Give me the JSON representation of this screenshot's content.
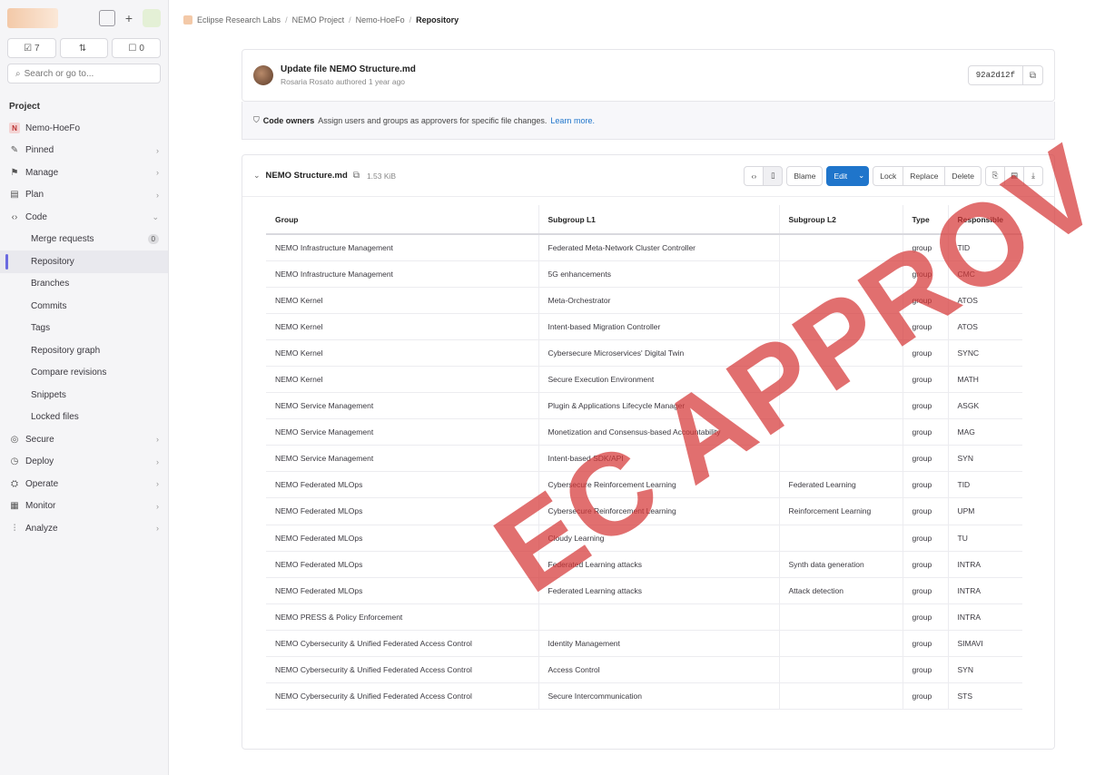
{
  "sidebar": {
    "counters": [
      "7",
      "",
      "0"
    ],
    "search_placeholder": "Search or go to...",
    "section_title": "Project",
    "project_name": "Nemo-HoeFo",
    "items": [
      {
        "label": "Pinned",
        "icon": "pin-icon"
      },
      {
        "label": "Manage",
        "icon": "manage-icon"
      },
      {
        "label": "Plan",
        "icon": "plan-icon"
      },
      {
        "label": "Code",
        "icon": "code-icon"
      }
    ],
    "code_sub": [
      {
        "label": "Merge requests",
        "badge": "0"
      },
      {
        "label": "Repository",
        "active": true
      },
      {
        "label": "Branches"
      },
      {
        "label": "Commits"
      },
      {
        "label": "Tags"
      },
      {
        "label": "Repository graph"
      },
      {
        "label": "Compare revisions"
      },
      {
        "label": "Snippets"
      },
      {
        "label": "Locked files"
      }
    ],
    "bottom_items": [
      {
        "label": "Secure",
        "icon": "shield-icon"
      },
      {
        "label": "Deploy",
        "icon": "deploy-icon"
      },
      {
        "label": "Operate",
        "icon": "operate-icon"
      },
      {
        "label": "Monitor",
        "icon": "monitor-icon"
      },
      {
        "label": "Analyze",
        "icon": "analyze-icon"
      }
    ]
  },
  "breadcrumb": [
    "Eclipse Research Labs",
    "NEMO Project",
    "Nemo-HoeFo",
    "Repository"
  ],
  "commit": {
    "title": "Update file NEMO Structure.md",
    "subtitle": "Rosaria Rosato authored 1 year ago",
    "sha": "92a2d12f"
  },
  "owners": {
    "label": "Code owners",
    "text": "Assign users and groups as approvers for specific file changes.",
    "link": "Learn more."
  },
  "file": {
    "name": "NEMO Structure.md",
    "size": "1.53 KiB",
    "actions": {
      "blame": "Blame",
      "edit": "Edit",
      "lock": "Lock",
      "replace": "Replace",
      "delete": "Delete"
    }
  },
  "table": {
    "headers": [
      "Group",
      "Subgroup L1",
      "Subgroup L2",
      "Type",
      "Responsible"
    ],
    "rows": [
      [
        "NEMO Infrastructure Management",
        "Federated Meta-Network Cluster Controller",
        "",
        "group",
        "TID"
      ],
      [
        "NEMO Infrastructure Management",
        "5G enhancements",
        "",
        "group",
        "CMC"
      ],
      [
        "NEMO Kernel",
        "Meta-Orchestrator",
        "",
        "group",
        "ATOS"
      ],
      [
        "NEMO Kernel",
        "Intent-based Migration Controller",
        "",
        "group",
        "ATOS"
      ],
      [
        "NEMO Kernel",
        "Cybersecure Microservices' Digital Twin",
        "",
        "group",
        "SYNC"
      ],
      [
        "NEMO Kernel",
        "Secure Execution Environment",
        "",
        "group",
        "MATH"
      ],
      [
        "NEMO Service Management",
        "Plugin & Applications Lifecycle Manager",
        "",
        "group",
        "ASGK"
      ],
      [
        "NEMO Service Management",
        "Monetization and Consensus-based Accountability",
        "",
        "group",
        "MAG"
      ],
      [
        "NEMO Service Management",
        "Intent-based SDK/API",
        "",
        "group",
        "SYN"
      ],
      [
        "NEMO Federated MLOps",
        "Cybersecure Reinforcement Learning",
        "Federated Learning",
        "group",
        "TID"
      ],
      [
        "NEMO Federated MLOps",
        "Cybersecure Reinforcement Learning",
        "Reinforcement Learning",
        "group",
        "UPM"
      ],
      [
        "NEMO Federated MLOps",
        "Cloudy Learning",
        "",
        "group",
        "TU"
      ],
      [
        "NEMO Federated MLOps",
        "Federated Learning attacks",
        "Synth data generation",
        "group",
        "INTRA"
      ],
      [
        "NEMO Federated MLOps",
        "Federated Learning attacks",
        "Attack detection",
        "group",
        "INTRA"
      ],
      [
        "NEMO PRESS & Policy Enforcement",
        "",
        "",
        "group",
        "INTRA"
      ],
      [
        "NEMO Cybersecurity & Unified Federated Access Control",
        "Identity Management",
        "",
        "group",
        "SIMAVI"
      ],
      [
        "NEMO Cybersecurity & Unified Federated Access Control",
        "Access Control",
        "",
        "group",
        "SYN"
      ],
      [
        "NEMO Cybersecurity & Unified Federated Access Control",
        "Secure Intercommunication",
        "",
        "group",
        "STS"
      ]
    ]
  },
  "watermark": "EC APPROV"
}
